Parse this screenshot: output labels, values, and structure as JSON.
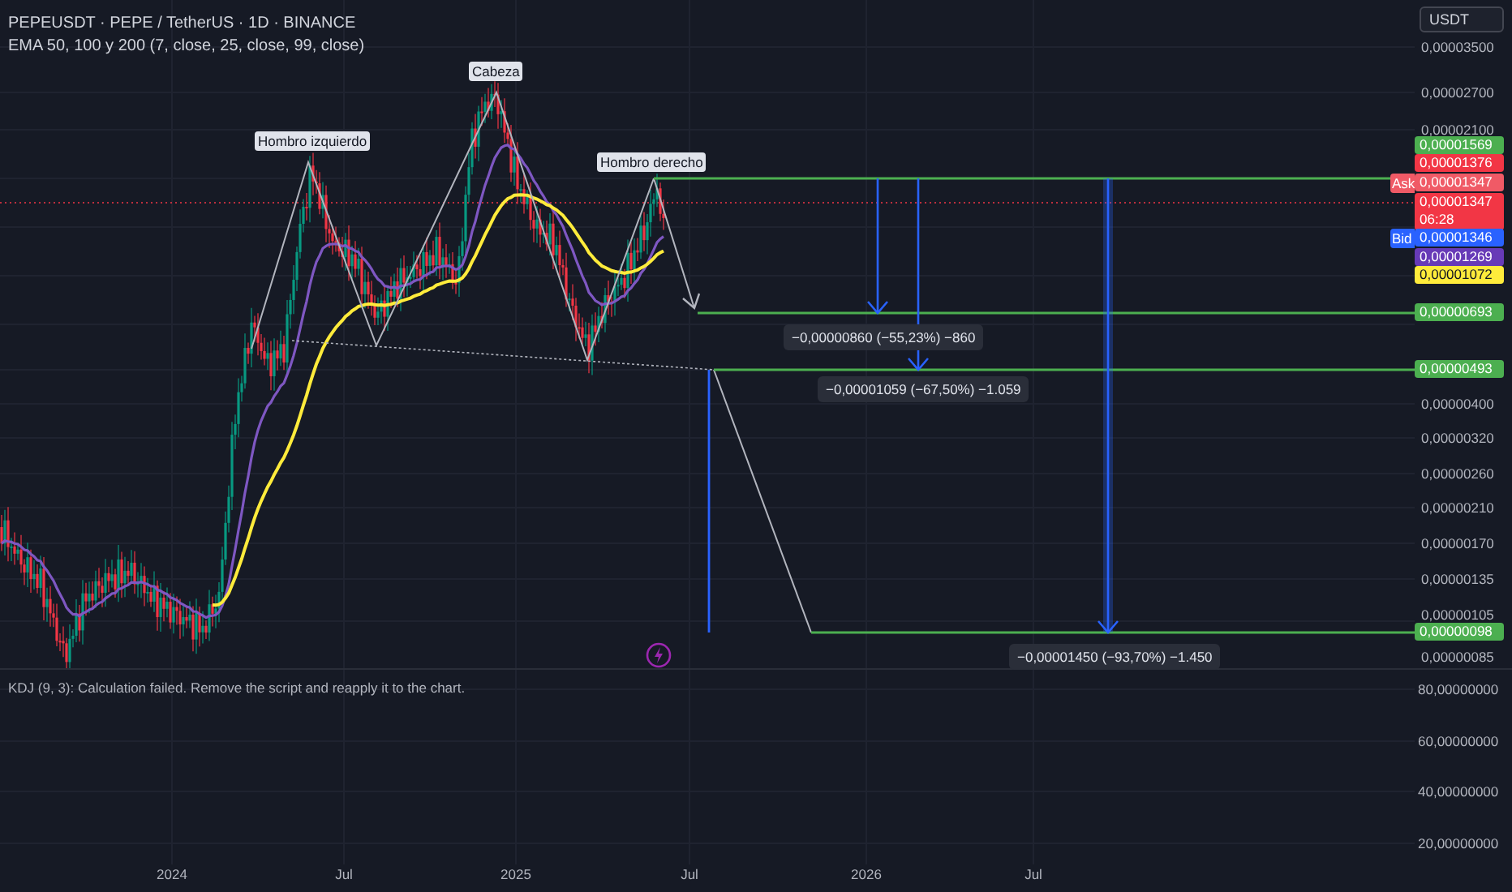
{
  "legend": {
    "title": "PEPEUSDT · PEPE / TetherUS · 1D · BINANCE",
    "indicator": "EMA 50, 100 y 200 (7, close, 25, close, 99, close)"
  },
  "currency_button": "USDT",
  "price_axis": {
    "labels": [
      "0,00003500",
      "0,00002700",
      "0,00002100",
      "0,00000400",
      "0,00000320",
      "0,00000260",
      "0,00000210",
      "0,00000170",
      "0,00000135",
      "0,00000105",
      "0,00000085"
    ]
  },
  "price_tags": [
    {
      "text": "0,00001569",
      "color": "#4caf50"
    },
    {
      "text": "0,00001376",
      "color": "#f23645"
    },
    {
      "text": "0,00001347",
      "color": "#f05a66",
      "side": "Ask"
    },
    {
      "text": "0,00001347",
      "color": "#f23645",
      "countdown": "06:28"
    },
    {
      "text": "0,00001346",
      "color": "#2962ff",
      "side": "Bid"
    },
    {
      "text": "0,00001269",
      "color": "#673ab7"
    },
    {
      "text": "0,00001072",
      "color": "#ffeb3b"
    },
    {
      "text": "0,00000693",
      "color": "#4caf50"
    },
    {
      "text": "0,00000493",
      "color": "#4caf50"
    },
    {
      "text": "0,00000098",
      "color": "#4caf50"
    }
  ],
  "annotations": [
    {
      "text": "Hombro izquierdo"
    },
    {
      "text": "Cabeza"
    },
    {
      "text": "Hombro derecho"
    }
  ],
  "measurements": [
    {
      "text": "−0,00000860 (−55,23%) −860"
    },
    {
      "text": "−0,00001059 (−67,50%) −1.059"
    },
    {
      "text": "−0,00001450 (−93,70%) −1.450"
    }
  ],
  "kdj_pane": {
    "message": "KDJ (9, 3): Calculation failed. Remove the script and reapply it to the chart.",
    "labels": [
      "80,00000000",
      "60,00000000",
      "40,00000000",
      "20,00000000"
    ]
  },
  "time_axis": {
    "labels": [
      "2024",
      "Jul",
      "2025",
      "Jul",
      "2026",
      "Jul"
    ]
  }
}
